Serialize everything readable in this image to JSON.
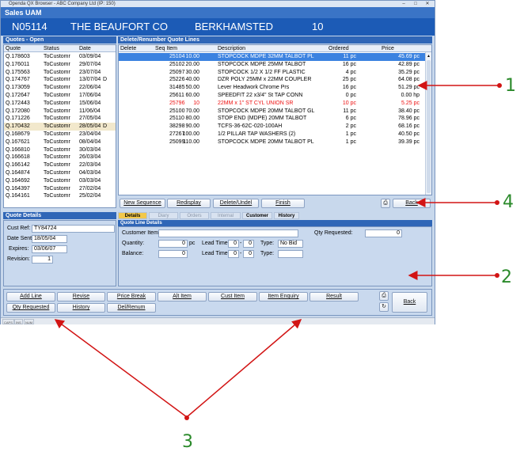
{
  "window": {
    "title": "Openda QX Browser - ABC Company Ltd (IP: 150)",
    "menu_title": "Sales UAM",
    "controls": [
      "minimize-icon",
      "maximize-icon",
      "close-icon"
    ]
  },
  "header": {
    "account": "N05114",
    "company": "THE BEAUFORT CO",
    "town": "BERKHAMSTED",
    "number": "10"
  },
  "quotes_panel": {
    "title": "Quotes   - Open",
    "columns": [
      "Quote",
      "Status",
      "Date"
    ],
    "rows": [
      {
        "quote": "Q.178603",
        "status": "ToCustomr",
        "date": "03/09/04",
        "flag": ""
      },
      {
        "quote": "Q.176011",
        "status": "ToCustomr",
        "date": "29/07/04",
        "flag": ""
      },
      {
        "quote": "Q.175563",
        "status": "ToCustomr",
        "date": "23/07/04",
        "flag": ""
      },
      {
        "quote": "Q.174767",
        "status": "ToCustomr",
        "date": "13/07/04",
        "flag": "D"
      },
      {
        "quote": "Q.173059",
        "status": "ToCustomr",
        "date": "22/06/04",
        "flag": ""
      },
      {
        "quote": "Q.172647",
        "status": "ToCustomr",
        "date": "17/06/04",
        "flag": ""
      },
      {
        "quote": "Q.172443",
        "status": "ToCustomr",
        "date": "15/06/04",
        "flag": ""
      },
      {
        "quote": "Q.172080",
        "status": "ToCustomr",
        "date": "11/06/04",
        "flag": ""
      },
      {
        "quote": "Q.171226",
        "status": "ToCustomr",
        "date": "27/05/04",
        "flag": ""
      },
      {
        "quote": "Q.170432",
        "status": "ToCustomr",
        "date": "28/05/04",
        "flag": "D"
      },
      {
        "quote": "Q.168679",
        "status": "ToCustomr",
        "date": "23/04/04",
        "flag": ""
      },
      {
        "quote": "Q.167621",
        "status": "ToCustomr",
        "date": "08/04/04",
        "flag": ""
      },
      {
        "quote": "Q.166810",
        "status": "ToCustomr",
        "date": "30/03/04",
        "flag": ""
      },
      {
        "quote": "Q.166618",
        "status": "ToCustomr",
        "date": "26/03/04",
        "flag": ""
      },
      {
        "quote": "Q.166142",
        "status": "ToCustomr",
        "date": "22/03/04",
        "flag": ""
      },
      {
        "quote": "Q.164874",
        "status": "ToCustomr",
        "date": "04/03/04",
        "flag": ""
      },
      {
        "quote": "Q.164692",
        "status": "ToCustomr",
        "date": "03/03/04",
        "flag": ""
      },
      {
        "quote": "Q.164397",
        "status": "ToCustomr",
        "date": "27/02/04",
        "flag": ""
      },
      {
        "quote": "Q.164161",
        "status": "ToCustomr",
        "date": "25/02/04",
        "flag": ""
      }
    ]
  },
  "lines_panel": {
    "title": "Delete/Renumber Quote Lines",
    "columns": [
      "Delete",
      "Seq Item",
      "Description",
      "Ordered",
      "Price"
    ],
    "rows": [
      {
        "seq": "10.00",
        "item": "25104",
        "description": "STOPCOCK MDPE 32MM TALBOT PL",
        "ordered": "11 pc",
        "price": "45.69 pc",
        "style": "selected"
      },
      {
        "seq": "20.00",
        "item": "25102",
        "description": "STOPCOCK MDPE 25MM TALBOT",
        "ordered": "16 pc",
        "price": "42.89 pc",
        "style": ""
      },
      {
        "seq": "30.00",
        "item": "25097",
        "description": "STOPCOCK 1/2 X 1/2 FF PLASTIC",
        "ordered": "4 pc",
        "price": "35.29 pc",
        "style": ""
      },
      {
        "seq": "40.00",
        "item": "25226",
        "description": "DZR POLY 25MM x 22MM COUPLER",
        "ordered": "25 pc",
        "price": "64.08 pc",
        "style": ""
      },
      {
        "seq": "50.00",
        "item": "31485",
        "description": "Lever Headwork Chrome Prs",
        "ordered": "16 pc",
        "price": "51.29 pc",
        "style": ""
      },
      {
        "seq": "60.00",
        "item": "25611",
        "description": "SPEEDFIT 22 x3/4\" St TAP CONN",
        "ordered": "0 pc",
        "price": "0.00 hp",
        "style": ""
      },
      {
        "seq": "10",
        "item": "25796",
        "description": "22MM x  1\" ST CYL UNION   SR",
        "ordered": "10 pc",
        "price": "5.25 pc",
        "style": "red"
      },
      {
        "seq": "70.00",
        "item": "25100",
        "description": "STOPCOCK MDPE 20MM TALBOT GL",
        "ordered": "11 pc",
        "price": "38.40 pc",
        "style": ""
      },
      {
        "seq": "80.00",
        "item": "25110",
        "description": "STOP END (MDPE) 20MM TALBOT",
        "ordered": "6 pc",
        "price": "78.96 pc",
        "style": ""
      },
      {
        "seq": "90.00",
        "item": "38298",
        "description": "TCFS-36-62C-020-100AH",
        "ordered": "2 pc",
        "price": "68.16 pc",
        "style": ""
      },
      {
        "seq": "100.00",
        "item": "27267",
        "description": "1/2 PILLAR TAP WASHERS (2)",
        "ordered": "1 pc",
        "price": "40.50 pc",
        "style": ""
      },
      {
        "seq": "110.00",
        "item": "25099",
        "description": "STOPCOCK MDPE 20MM TALBOT PL",
        "ordered": "1 pc",
        "price": "39.39 pc",
        "style": ""
      }
    ],
    "buttons": {
      "new_sequence": "New Sequence",
      "redisplay": "Redisplay",
      "delete_undel": "Delete/Undel",
      "finish": "Finish",
      "back": "Back"
    }
  },
  "quote_details": {
    "title": "Quote Details",
    "cust_ref_label": "Cust Ref:",
    "cust_ref": "TY84724",
    "date_sent_label": "Date Sent:",
    "date_sent": "18/05/04",
    "expires_label": "Expires:",
    "expires": "03/06/07",
    "revision_label": "Revision:",
    "revision": "1"
  },
  "tabs": [
    "Details",
    "Diary",
    "Orders",
    "Internal",
    "Customer",
    "History"
  ],
  "line_details": {
    "title": "Quote Line Details",
    "customer_item_label": "Customer Item:",
    "customer_item": "",
    "qty_requested_label": "Qty Requested:",
    "qty_requested": "0",
    "quantity_label": "Quantity:",
    "quantity": "0",
    "quantity_unit": "pc",
    "lead_time_label": "Lead Time:",
    "lead_time_1a": "0",
    "lead_time_1b": "0",
    "type_label": "Type:",
    "type_1": "No Bid",
    "balance_label": "Balance:",
    "balance": "0",
    "lead_time_2a": "0",
    "lead_time_2b": "0",
    "type_2": ""
  },
  "bottom_buttons": {
    "add_line": "Add Line",
    "revise": "Revise",
    "price_break": "Price Break",
    "alt_item": "Alt Item",
    "cust_item": "Cust Item",
    "item_enquiry": "Item Enquiry",
    "result": "Result",
    "qty_requested": "Qty Requested",
    "history": "History",
    "del_renum": "Del/Renum",
    "back": "Back"
  },
  "status_bar": [
    "CAPS",
    "INS",
    "NUM"
  ],
  "callouts": [
    "1",
    "2",
    "3",
    "4"
  ],
  "colors": {
    "header_blue": "#1c5bb6",
    "panel_title_blue": "#2f66b7",
    "selected_row": "#3b82e0",
    "warning_red": "#e11111",
    "active_tab": "#f2c84b",
    "callout_green": "#2b8a2b",
    "arrow_red": "#d21414"
  }
}
